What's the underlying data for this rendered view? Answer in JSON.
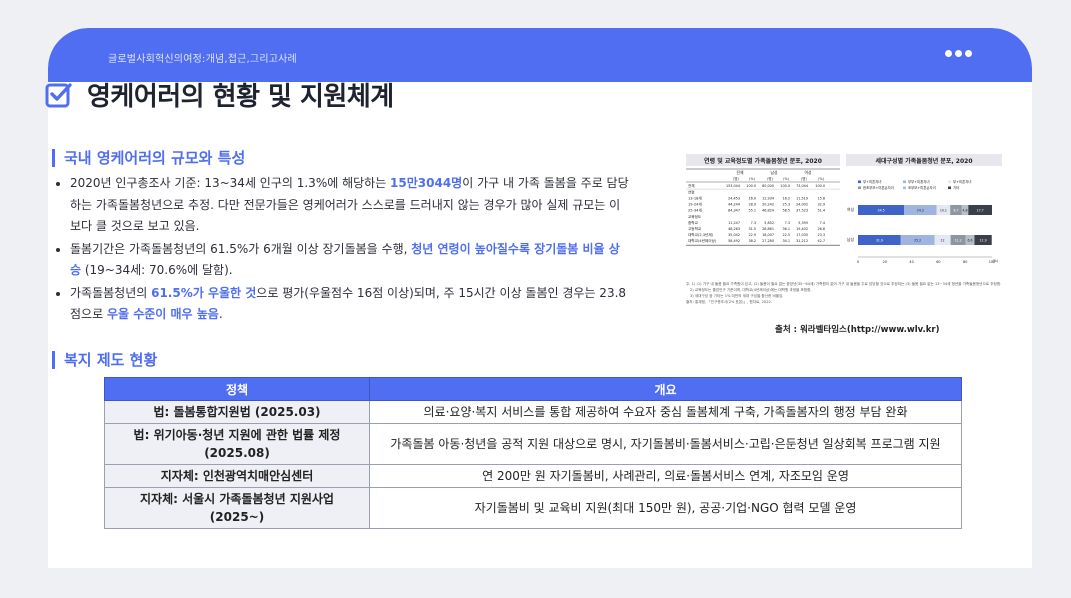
{
  "header": {
    "title": "글로벌사회혁신의여정:개념,접근,그리고사례"
  },
  "page_title": "영케어러의 현황 및 지원체계",
  "section1": {
    "title": "국내 영케어러의 규모와 특성",
    "b1": {
      "t1": "2020년 인구총조사 기준: 13~34세 인구의 1.3%에 해당하는 ",
      "hl": "15만3044명",
      "t2": "이 가구 내 가족 돌봄을 주로 담당하는 가족돌봄청년으로 추정. 다만 전문가들은 영케어러가 스스로를 드러내지 않는 경우가 많아 실제 규모는 이보다 클 것으로 보고 있음."
    },
    "b2": {
      "t1": "돌봄기간은 가족돌봄청년의 61.5%가 6개월 이상 장기돌봄을 수행, ",
      "hl": "청년 연령이 높아질수록 장기돌봄 비율 상승",
      "t2": " (19~34세: 70.6%에 달함)."
    },
    "b3": {
      "t1": "가족돌봄청년의 ",
      "hl1": "61.5%가 우울한 것",
      "t2": "으로 평가(우울점수 16점 이상)되며, 주 15시간 이상 돌봄인 경우는 23.8점으로 ",
      "hl2": "우울 수준이 매우 높음",
      "t3": "."
    }
  },
  "figure": {
    "left_title": "연령 및 교육정도별 가족돌봄청년 분포, 2020",
    "right_title": "세대구성별 가족돌봄청년 분포, 2020",
    "col_heads": [
      "전체",
      "남성",
      "여성"
    ],
    "sub_heads": [
      "(명)",
      "(%)",
      "(명)",
      "(%)",
      "(명)",
      "(%)"
    ],
    "rows": [
      {
        "label": "전체",
        "vals": [
          "153,044",
          "100.0",
          "80,000",
          "100.0",
          "73,044",
          "100.0"
        ]
      },
      {
        "label": "연령",
        "vals": [
          "",
          "",
          "",
          "",
          "",
          ""
        ]
      },
      {
        "label": "13-18세",
        "vals": [
          "24,453",
          "16.0",
          "12,934",
          "16.2",
          "11,519",
          "15.8"
        ]
      },
      {
        "label": "19-24세",
        "vals": [
          "44,244",
          "28.9",
          "20,242",
          "25.3",
          "24,002",
          "32.9"
        ]
      },
      {
        "label": "25-34세",
        "vals": [
          "84,347",
          "55.1",
          "46,824",
          "58.5",
          "37,523",
          "51.4"
        ]
      },
      {
        "label": "교육정도",
        "vals": [
          "",
          "",
          "",
          "",
          "",
          ""
        ]
      },
      {
        "label": "중학교",
        "vals": [
          "11,247",
          "7.3",
          "5,852",
          "7.3",
          "5,395",
          "7.4"
        ]
      },
      {
        "label": "고등학교",
        "vals": [
          "48,263",
          "31.5",
          "28,861",
          "36.1",
          "19,402",
          "26.6"
        ]
      },
      {
        "label": "대학교(2,3년제)",
        "vals": [
          "35,042",
          "22.9",
          "18,007",
          "22.5",
          "17,035",
          "23.3"
        ]
      },
      {
        "label": "대학교(4년제이상)",
        "vals": [
          "58,492",
          "38.2",
          "27,280",
          "34.1",
          "31,212",
          "42.7"
        ]
      }
    ],
    "legend": [
      "부+미혼자녀",
      "부부+미혼자녀",
      "부+미혼자녀",
      "한조부모+미혼손자녀",
      "조부모+미혼손자녀",
      "기타"
    ],
    "bars": [
      {
        "label": "여성",
        "segments": [
          34.5,
          24.2,
          10.1,
          8.7,
          4.8,
          17.7
        ]
      },
      {
        "label": "남성",
        "segments": [
          31.9,
          25.2,
          12.0,
          11.2,
          6.6,
          12.9
        ]
      }
    ],
    "bar_colors": [
      "#3f63c7",
      "#9fb4e0",
      "#e4e8f0",
      "#8f96a3",
      "#b8bec8",
      "#3a3f4a"
    ],
    "axis_ticks": [
      "0",
      "20",
      "40",
      "60",
      "80",
      "100"
    ],
    "axis_unit": "(%)",
    "note1": "주: 1) (1) 가구 내 돌봄 필요 가족원이 있고, (2) 돌봄이 필요 없는 중장년(35~64세) 가족원이 없어 가구 내 돌봄을 주로 담당할 것으로 추정되는 (3) 돌봄 필요 없는 13~34세 청년을 가족돌봄청년으로 추정함.",
    "note2": "2) 교육정도는 졸업인구 기준이며, 대학교(4년제이상)에는 대학원 과정을 포함함.",
    "note3": "3) 세대구성 중 기타는 1% 미만의 세대 구성을 합산한 비율임.",
    "source_note": "출처: 통계청, 「인구총조사(2% 표본)」, 원자료, 2022.",
    "caption": "출처 : 워라벨타임스(http://www.wlv.kr)"
  },
  "section2": {
    "title": "복지 제도 현황"
  },
  "table": {
    "headers": [
      "정책",
      "개요"
    ],
    "rows": [
      [
        "법: 돌봄통합지원법 (2025.03)",
        "의료·요양·복지 서비스를 통합 제공하여 수요자 중심 돌봄체계 구축, 가족돌봄자의 행정 부담 완화"
      ],
      [
        "법: 위기아동·청년 지원에 관한 법률 제정 (2025.08)",
        "가족돌봄 아동·청년을 공적 지원 대상으로 명시, 자기돌봄비·돌봄서비스·고립·은둔청년 일상회복 프로그램 지원"
      ],
      [
        "지자체: 인천광역치매안심센터",
        "연 200만 원 자기돌봄비, 사례관리, 의료·돌봄서비스 연계, 자조모임 운영"
      ],
      [
        "지자체: 서울시 가족돌봄청년 지원사업 (2025~)",
        "자기돌봄비 및 교육비 지원(최대 150만 원), 공공·기업·NGO 협력 모델 운영"
      ]
    ]
  },
  "colors": {
    "accent": "#4f6ef2",
    "text": "#2c2f38"
  }
}
